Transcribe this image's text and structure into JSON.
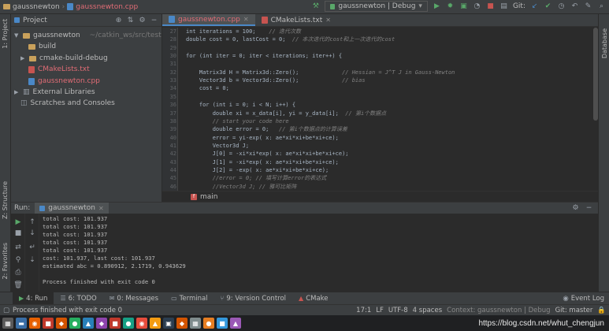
{
  "titlebar": {
    "project": "gaussnewton",
    "file": "gaussnewton.cpp",
    "run_config": "gaussnewton | Debug",
    "git_label": "Git:"
  },
  "leftstrip": {
    "project_label": "1: Project",
    "structure_label": "Z: Structure",
    "favorites_label": "2: Favorites"
  },
  "rightstrip": {
    "database_label": "Database"
  },
  "project_panel": {
    "title": "Project",
    "items": [
      {
        "label": "gaussnewton",
        "path": "~/catkin_ws/src/test"
      },
      {
        "label": "build"
      },
      {
        "label": "cmake-build-debug"
      },
      {
        "label": "CMakeLists.txt"
      },
      {
        "label": "gaussnewton.cpp"
      },
      {
        "label": "External Libraries"
      },
      {
        "label": "Scratches and Consoles"
      }
    ]
  },
  "editor": {
    "tabs": [
      {
        "label": "gaussnewton.cpp"
      },
      {
        "label": "CMakeLists.txt"
      }
    ],
    "breadcrumb": "main",
    "lines": [
      {
        "n": "27",
        "text": "int iterations = 100;    // 迭代次数"
      },
      {
        "n": "28",
        "text": "double cost = 0, lastCost = 0;  // 本次迭代的cost和上一次迭代的cost"
      },
      {
        "n": "29",
        "text": ""
      },
      {
        "n": "30",
        "text": "for (int iter = 0; iter < iterations; iter++) {"
      },
      {
        "n": "31",
        "text": ""
      },
      {
        "n": "32",
        "text": "    Matrix3d H = Matrix3d::Zero();             // Hessian = J^T J in Gauss-Newton"
      },
      {
        "n": "33",
        "text": "    Vector3d b = Vector3d::Zero();             // bias"
      },
      {
        "n": "34",
        "text": "    cost = 0;"
      },
      {
        "n": "35",
        "text": ""
      },
      {
        "n": "36",
        "text": "    for (int i = 0; i < N; i++) {"
      },
      {
        "n": "37",
        "text": "        double xi = x_data[i], yi = y_data[i];  // 第i个数据点"
      },
      {
        "n": "38",
        "text": "        // start your code here"
      },
      {
        "n": "39",
        "text": "        double error = 0;   // 第i个数据点的计算误差"
      },
      {
        "n": "40",
        "text": "        error = yi-exp( x: ae*xi*xi+be*xi+ce);"
      },
      {
        "n": "41",
        "text": "        Vector3d J;"
      },
      {
        "n": "42",
        "text": "        J[0] = -xi*xi*exp( x: ae*xi*xi+be*xi+ce);"
      },
      {
        "n": "43",
        "text": "        J[1] = -xi*exp( x: ae*xi*xi+be*xi+ce);"
      },
      {
        "n": "44",
        "text": "        J[2] = -exp( x: ae*xi*xi+be*xi+ce);"
      },
      {
        "n": "45",
        "text": "        //error = 0; // 填写计算error的表达式"
      },
      {
        "n": "46",
        "text": "        //Vector3d J; // 雅可比矩阵"
      }
    ]
  },
  "run_panel": {
    "label": "Run:",
    "tab": "gaussnewton",
    "console": [
      "total cost: 101.937",
      "total cost: 101.937",
      "total cost: 101.937",
      "total cost: 101.937",
      "total cost: 101.937",
      "cost: 101.937, last cost: 101.937",
      "estimated abc = 0.890912, 2.1719, 0.943629",
      "",
      "Process finished with exit code 0"
    ]
  },
  "tooltabs": {
    "tabs": [
      {
        "label": "4: Run"
      },
      {
        "label": "6: TODO"
      },
      {
        "label": "0: Messages"
      },
      {
        "label": "Terminal"
      },
      {
        "label": "9: Version Control"
      },
      {
        "label": "CMake"
      }
    ],
    "event_log": "Event Log"
  },
  "statusbar": {
    "message": "Process finished with exit code 0",
    "position": "17:1",
    "line_sep": "LF",
    "encoding": "UTF-8",
    "indent": "4 spaces",
    "context": "Context: gaussnewton | Debug",
    "git": "Git: master"
  },
  "watermark": "https://blog.csdn.net/whut_chengjun"
}
